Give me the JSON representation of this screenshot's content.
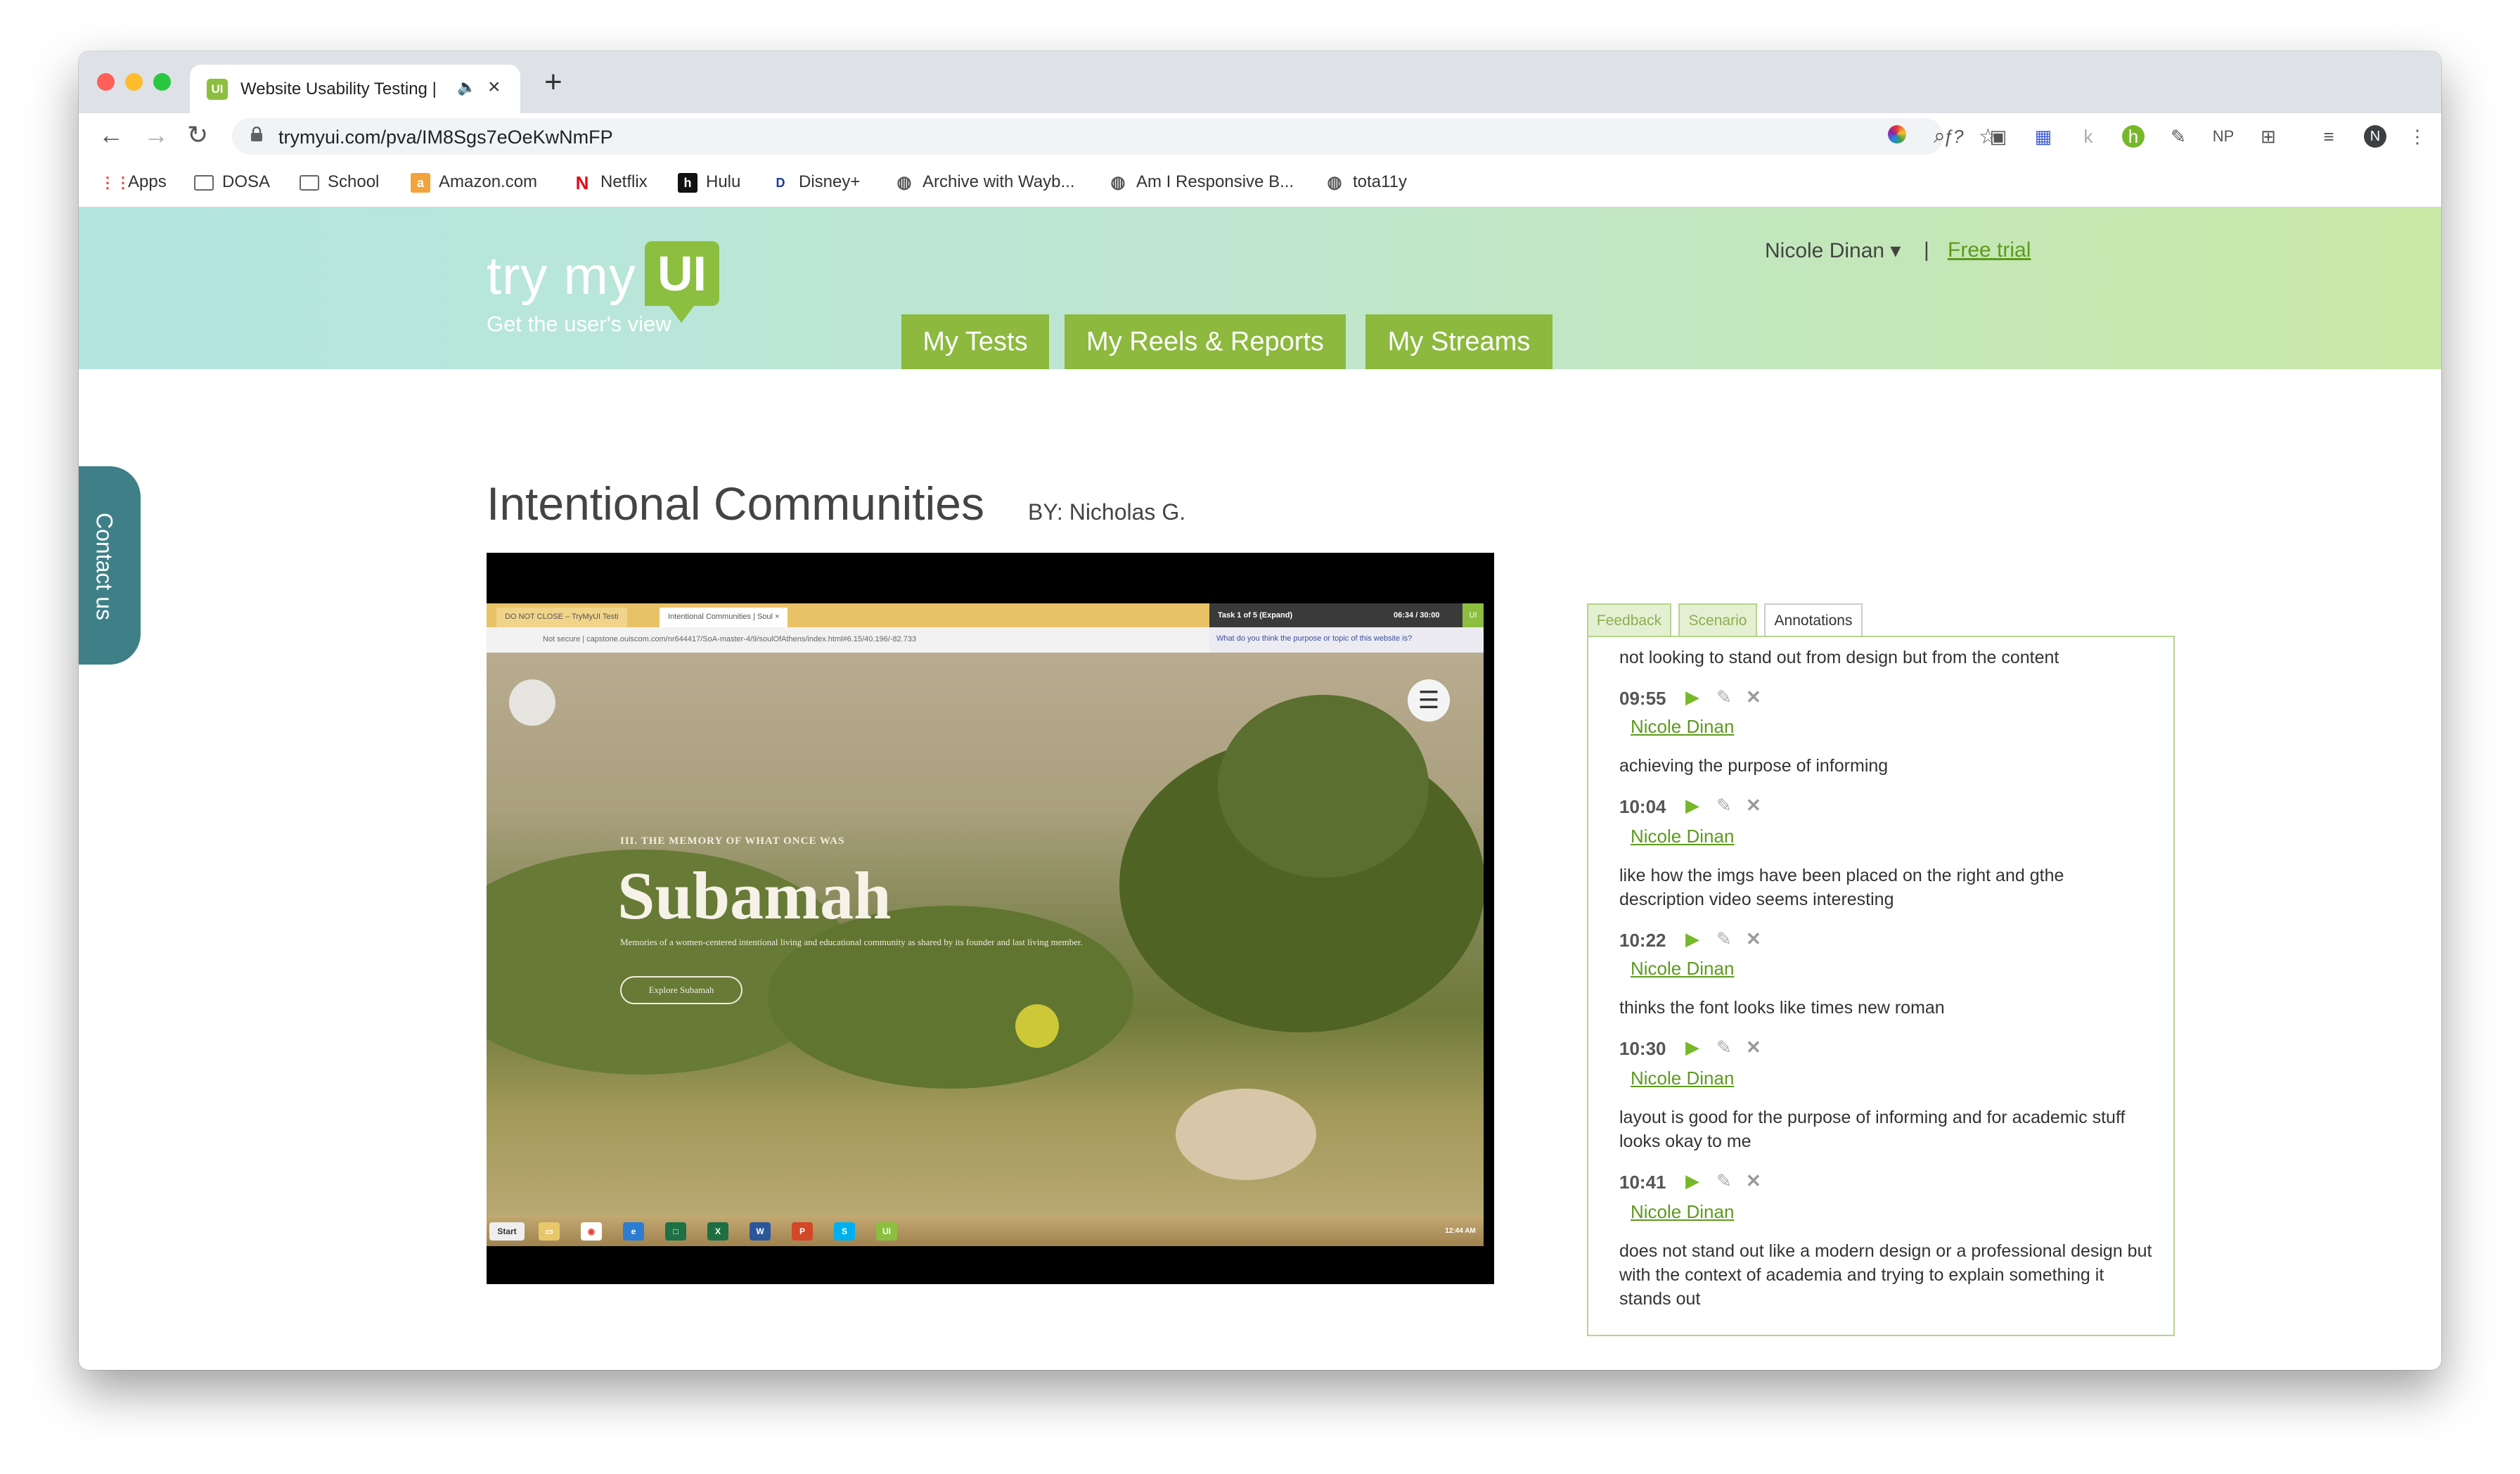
{
  "browser": {
    "tab_title": "Website Usability Testing |",
    "tab_favicon": "UI",
    "url": "trymyui.com/pva/IM8Sgs7eOeKwNmFP",
    "profile_initial": "N",
    "np_label": "NP",
    "bookmarks": [
      "Apps",
      "DOSA",
      "School",
      "Amazon.com",
      "Netflix",
      "Hulu",
      "Disney+",
      "Archive with Wayb...",
      "Am I Responsive B...",
      "tota11y"
    ]
  },
  "site": {
    "logo_text": "try my",
    "logo_badge": "UI",
    "tagline": "Get the user's view",
    "user_menu": "Nicole Dinan ▾",
    "separator": "|",
    "free_trial": "Free trial",
    "nav": [
      "My Tests",
      "My Reels & Reports",
      "My Streams"
    ],
    "contact": "Contact us",
    "accent": "#8cb93e"
  },
  "test": {
    "title": "Intentional Communities",
    "by": "BY:  Nicholas G."
  },
  "video": {
    "tab1": "DO NOT CLOSE – TryMyUI Testi",
    "tab2": "Intentional Communities | Soul ×",
    "address": "Not secure  |  capstone.ouiscom.com/nr644417/SoA-master-4/9/soulOfAthens/index.html#6.15/40.196/-82.733",
    "task": "Task 1 of 5 (Expand)",
    "timer": "06:34 / 30:00",
    "question": "What do you think the purpose or topic of this website is?",
    "kicker": "III. THE MEMORY OF WHAT ONCE WAS",
    "headline": "Subamah",
    "description": "Memories of a women-centered intentional living and educational community as shared by its founder and last living member.",
    "button": "Explore Subamah",
    "start": "Start",
    "clock": "12:44 AM"
  },
  "panel": {
    "tabs": [
      "Feedback",
      "Scenario",
      "Annotations"
    ],
    "active_tab": "Annotations",
    "first_note": "not looking to stand out from design but from the content",
    "annotations": [
      {
        "time": "09:55",
        "author": "Nicole Dinan",
        "text": "achieving the purpose of informing"
      },
      {
        "time": "10:04",
        "author": "Nicole Dinan",
        "text": "like how the imgs have been placed on the right and gthe description video seems interesting"
      },
      {
        "time": "10:22",
        "author": "Nicole Dinan",
        "text": "thinks the font looks like times new roman"
      },
      {
        "time": "10:30",
        "author": "Nicole Dinan",
        "text": "layout is good for the purpose of informing and for academic stuff looks okay to me"
      },
      {
        "time": "10:41",
        "author": "Nicole Dinan",
        "text": "does not stand out like a modern design or a professional design but with the context of academia and trying to explain something it stands out"
      }
    ]
  }
}
